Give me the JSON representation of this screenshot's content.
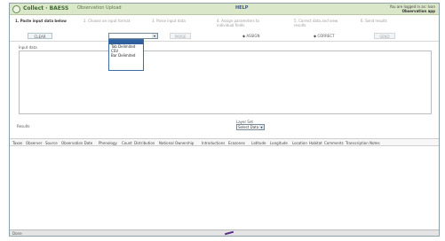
{
  "header": {
    "app_title": "Collect · BAESS",
    "app_subtitle": "Observation Upload",
    "help": "HELP",
    "user_line_1": "You are logged in as: Ivan",
    "user_line_2": "Observation app"
  },
  "steps": [
    {
      "label": "1. Paste input data below",
      "active": true
    },
    {
      "label": "2. Choose an input format",
      "active": false
    },
    {
      "label": "3. Parse input data",
      "active": false
    },
    {
      "label": "4. Assign parameters to individual fields",
      "active": false
    },
    {
      "label": "5. Correct data and view results",
      "active": false
    },
    {
      "label": "6. Send results",
      "active": false
    }
  ],
  "buttons": {
    "clear": "CLEAR",
    "parse": "PARSE",
    "assign": "ASSIGN",
    "correct": "CORRECT",
    "send": "SEND"
  },
  "format_select": {
    "value": "",
    "options": [
      "",
      "Tab Delimited",
      "CSV",
      "Bar Delimited"
    ],
    "selected_index": 0
  },
  "input": {
    "label": "Input data"
  },
  "results": {
    "label": "Results",
    "layer_label": "Layer Set",
    "layer_value": "Select Data"
  },
  "table": {
    "columns": [
      "Taxon",
      "Observer",
      "Source",
      "Observation Date",
      "Phenology",
      "Count",
      "Distribution",
      "National Ownership",
      "Introductions",
      "Ecozones",
      "Latitude",
      "Longitude",
      "Location",
      "Habitat",
      "Comments",
      "Transcription Notes"
    ]
  },
  "status": {
    "text": "Done"
  },
  "colors": {
    "header_bg": "#dbe7c9",
    "accent": "#3d6a2e",
    "dropdown_highlight": "#2f5f9e"
  }
}
